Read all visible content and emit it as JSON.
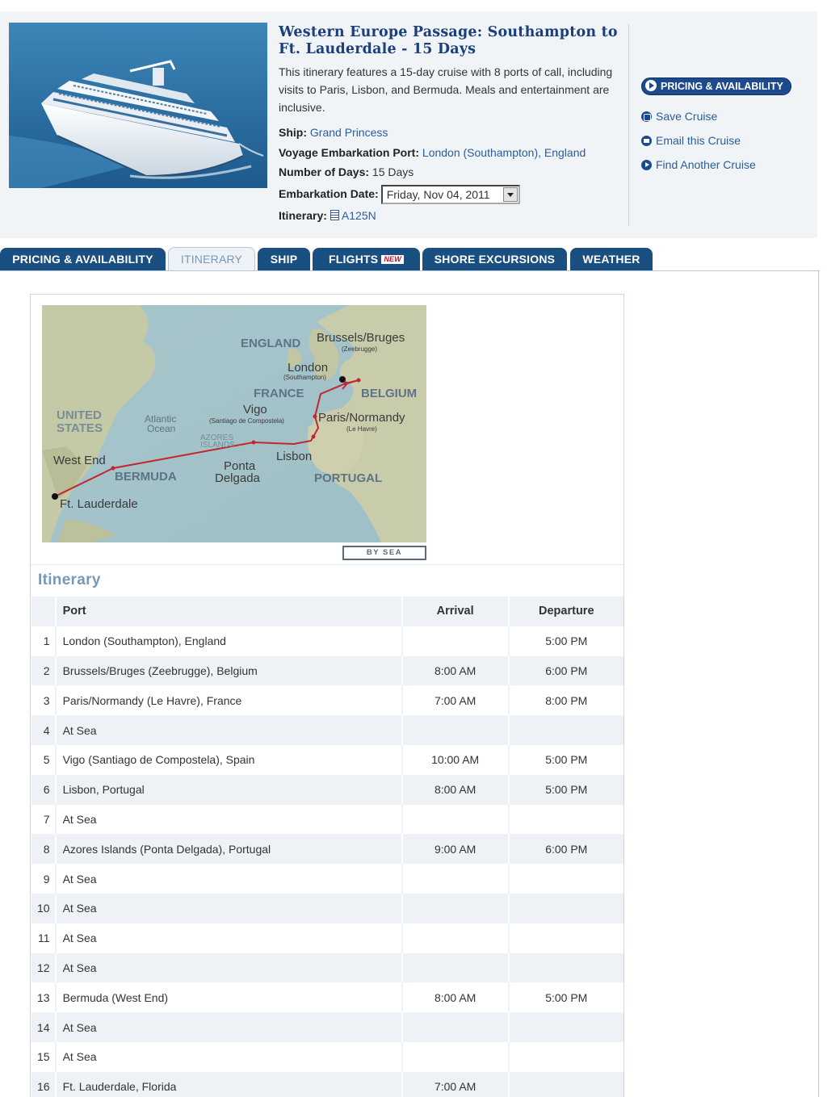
{
  "cruise": {
    "title": "Western Europe Passage: Southampton to Ft. Lauderdale - 15 Days",
    "description": "This itinerary features a 15-day cruise with 8 ports of call, including visits to Paris, Lisbon, and Bermuda. Meals and entertainment are inclusive.",
    "ship_label": "Ship:",
    "ship_value": "Grand Princess",
    "embark_port_label": "Voyage Embarkation Port:",
    "embark_port_value": "London (Southampton), England",
    "days_label": "Number of Days:",
    "days_value": "15 Days",
    "embark_date_label": "Embarkation Date:",
    "embark_date_value": "Friday, Nov 04, 2011",
    "itinerary_label": "Itinerary:",
    "itinerary_code": "A125N"
  },
  "side_actions": {
    "pricing_button": "PRICING & AVAILABILITY",
    "save": "Save Cruise",
    "email": "Email this Cruise",
    "find": "Find Another Cruise"
  },
  "tabs": [
    {
      "label": "PRICING & AVAILABILITY",
      "active": false
    },
    {
      "label": "ITINERARY",
      "active": true
    },
    {
      "label": "SHIP",
      "active": false
    },
    {
      "label": "FLIGHTS",
      "badge": "NEW",
      "active": false
    },
    {
      "label": "SHORE EXCURSIONS",
      "active": false
    },
    {
      "label": "WEATHER",
      "active": false
    }
  ],
  "map": {
    "labels": {
      "england": "ENGLAND",
      "brussels": "Brussels/Bruges",
      "zeebrugge": "(Zeebrugge)",
      "london": "London",
      "southampton": "(Southampton)",
      "france": "FRANCE",
      "belgium": "BELGIUM",
      "vigo": "Vigo",
      "santiago": "(Santiago de Compostela)",
      "paris": "Paris/Normandy",
      "lehavre": "(Le Havre)",
      "us1": "UNITED",
      "us2": "STATES",
      "ocean1": "Atlantic",
      "ocean2": "Ocean",
      "azores1": "AZORES",
      "azores2": "ISLANDS",
      "lisbon": "Lisbon",
      "westend": "West End",
      "bermuda": "BERMUDA",
      "ponta1": "Ponta",
      "ponta2": "Delgada",
      "portugal": "PORTUGAL",
      "ftl": "Ft. Lauderdale"
    },
    "by_sea": "BY SEA"
  },
  "itinerary": {
    "heading": "Itinerary",
    "columns": {
      "port": "Port",
      "arrival": "Arrival",
      "departure": "Departure"
    },
    "rows": [
      {
        "num": "1",
        "port": "London (Southampton), England",
        "arrival": "",
        "departure": "5:00 PM"
      },
      {
        "num": "2",
        "port": "Brussels/Bruges (Zeebrugge), Belgium",
        "arrival": "8:00 AM",
        "departure": "6:00 PM"
      },
      {
        "num": "3",
        "port": "Paris/Normandy (Le Havre), France",
        "arrival": "7:00 AM",
        "departure": "8:00 PM"
      },
      {
        "num": "4",
        "port": "At Sea",
        "arrival": "",
        "departure": ""
      },
      {
        "num": "5",
        "port": "Vigo (Santiago de Compostela), Spain",
        "arrival": "10:00 AM",
        "departure": "5:00 PM"
      },
      {
        "num": "6",
        "port": "Lisbon, Portugal",
        "arrival": "8:00 AM",
        "departure": "5:00 PM"
      },
      {
        "num": "7",
        "port": "At Sea",
        "arrival": "",
        "departure": ""
      },
      {
        "num": "8",
        "port": "Azores Islands (Ponta Delgada), Portugal",
        "arrival": "9:00 AM",
        "departure": "6:00 PM"
      },
      {
        "num": "9",
        "port": "At Sea",
        "arrival": "",
        "departure": ""
      },
      {
        "num": "10",
        "port": "At Sea",
        "arrival": "",
        "departure": ""
      },
      {
        "num": "11",
        "port": "At Sea",
        "arrival": "",
        "departure": ""
      },
      {
        "num": "12",
        "port": "At Sea",
        "arrival": "",
        "departure": ""
      },
      {
        "num": "13",
        "port": "Bermuda (West End)",
        "arrival": "8:00 AM",
        "departure": "5:00 PM"
      },
      {
        "num": "14",
        "port": "At Sea",
        "arrival": "",
        "departure": ""
      },
      {
        "num": "15",
        "port": "At Sea",
        "arrival": "",
        "departure": ""
      },
      {
        "num": "16",
        "port": "Ft. Lauderdale, Florida",
        "arrival": "7:00 AM",
        "departure": ""
      }
    ]
  }
}
